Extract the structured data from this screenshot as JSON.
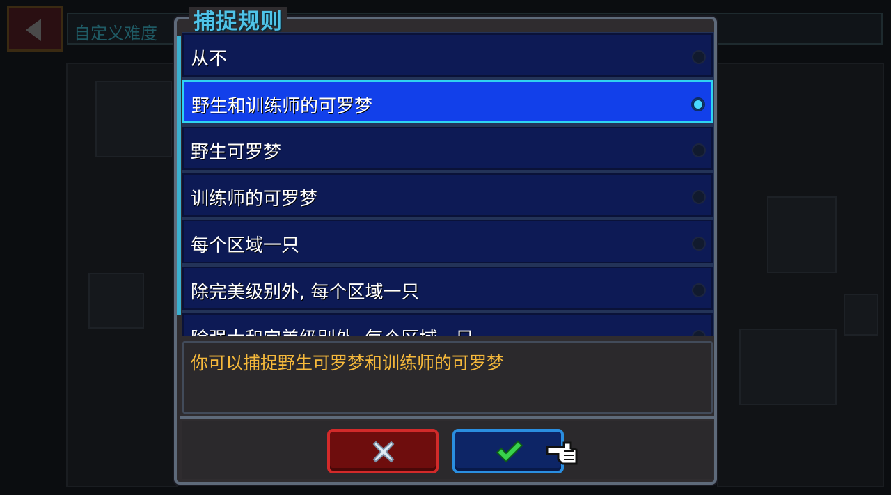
{
  "background": {
    "title": "自定义难度"
  },
  "dialog": {
    "title": "捕捉规则",
    "selected_index": 1,
    "options": [
      {
        "label": "从不"
      },
      {
        "label": "野生和训练师的可罗梦"
      },
      {
        "label": "野生可罗梦"
      },
      {
        "label": "训练师的可罗梦"
      },
      {
        "label": "每个区域一只"
      },
      {
        "label": "除完美级别外, 每个区域一只"
      },
      {
        "label": "除强大和完美级别外, 每个区域一只"
      }
    ],
    "description": "你可以捕捉野生可罗梦和训练师的可罗梦",
    "buttons": {
      "cancel_icon": "close-icon",
      "confirm_icon": "check-icon"
    }
  },
  "colors": {
    "title": "#4fc3e8",
    "description": "#f6b93b",
    "selected_row": "#1240ea",
    "row": "#0d1a55",
    "cancel": "#d22a2a",
    "confirm": "#2a8ee0"
  }
}
